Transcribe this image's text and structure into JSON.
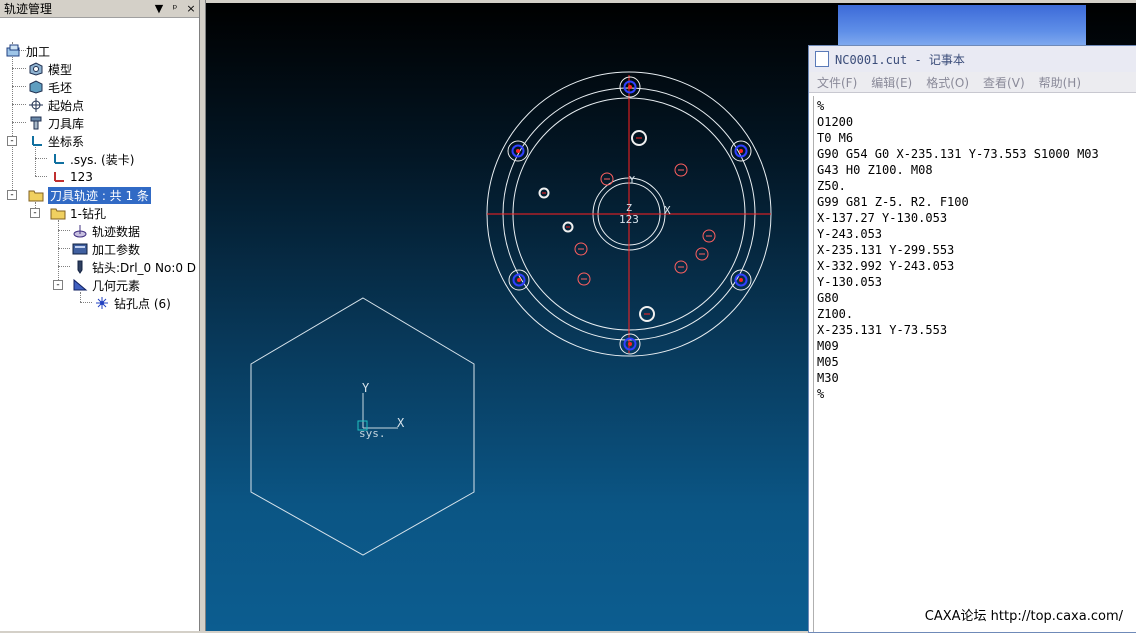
{
  "panel": {
    "title": "轨迹管理",
    "buttons": [
      "▼",
      "ᵖ",
      "×"
    ],
    "items": [
      {
        "label": "加工"
      },
      {
        "label": "模型"
      },
      {
        "label": "毛坯"
      },
      {
        "label": "起始点"
      },
      {
        "label": "刀具库"
      },
      {
        "label": "坐标系"
      },
      {
        "label": ".sys. (装卡)"
      },
      {
        "label": "123"
      },
      {
        "label": "刀具轨迹 : 共 1 条"
      },
      {
        "label": "1-钻孔"
      },
      {
        "label": "轨迹数据"
      },
      {
        "label": "加工参数"
      },
      {
        "label": "钻头:Drl_0 No:0 D"
      },
      {
        "label": "几何元素"
      },
      {
        "label": "钻孔点 (6)"
      }
    ],
    "expanders": [
      "-",
      "-",
      "-",
      "-",
      "-"
    ]
  },
  "canvas": {
    "axis_labels": {
      "y": "Y",
      "x": "X",
      "z": "Z",
      "sys_label": "sys.",
      "y2": "Y",
      "x2": "X",
      "c_label": "123"
    }
  },
  "notepad": {
    "title": "NC0001.cut - 记事本",
    "menu": [
      "文件(F)",
      "编辑(E)",
      "格式(O)",
      "查看(V)",
      "帮助(H)"
    ],
    "lines": [
      "%",
      "O1200",
      "T0 M6",
      "G90 G54 G0 X-235.131 Y-73.553 S1000 M03",
      "G43 H0 Z100. M08",
      "Z50.",
      "G99 G81 Z-5. R2. F100",
      "X-137.27 Y-130.053",
      "Y-243.053",
      "X-235.131 Y-299.553",
      "X-332.992 Y-243.053",
      "Y-130.053",
      "G80",
      "Z100.",
      "X-235.131 Y-73.553",
      "M09",
      "M05",
      "M30",
      "%"
    ]
  },
  "watermark": "CAXA论坛 http://top.caxa.com/",
  "colors": {
    "selection": "#316ac5",
    "canvas_bottom": "#0c5d90",
    "drill_red": "#ff2020",
    "hole_blue": "#3040ff"
  }
}
